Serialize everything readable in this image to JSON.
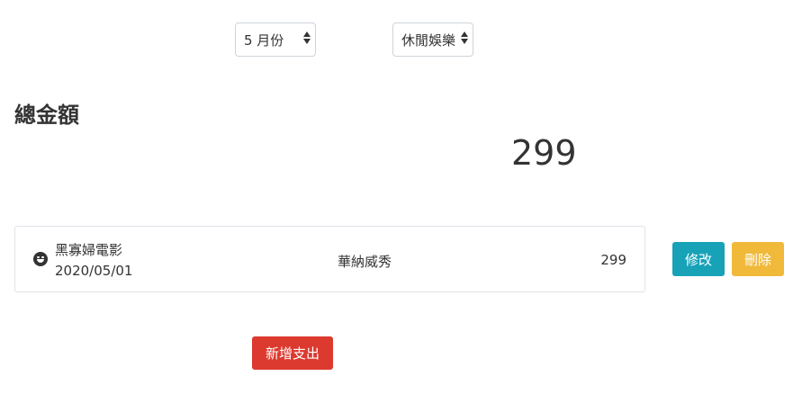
{
  "filters": {
    "month": {
      "selected": "5 月份"
    },
    "category": {
      "selected": "休閒娛樂"
    }
  },
  "summary": {
    "label": "總金額",
    "total": "299"
  },
  "expenses": [
    {
      "name": "黑寡婦電影",
      "date": "2020/05/01",
      "note": "華納威秀",
      "amount": "299",
      "icon": "smile-icon"
    }
  ],
  "actions": {
    "edit_label": "修改",
    "delete_label": "刪除",
    "add_label": "新增支出"
  },
  "colors": {
    "edit": "#17a2b8",
    "delete": "#f0b93a",
    "add": "#dc3a2f"
  }
}
